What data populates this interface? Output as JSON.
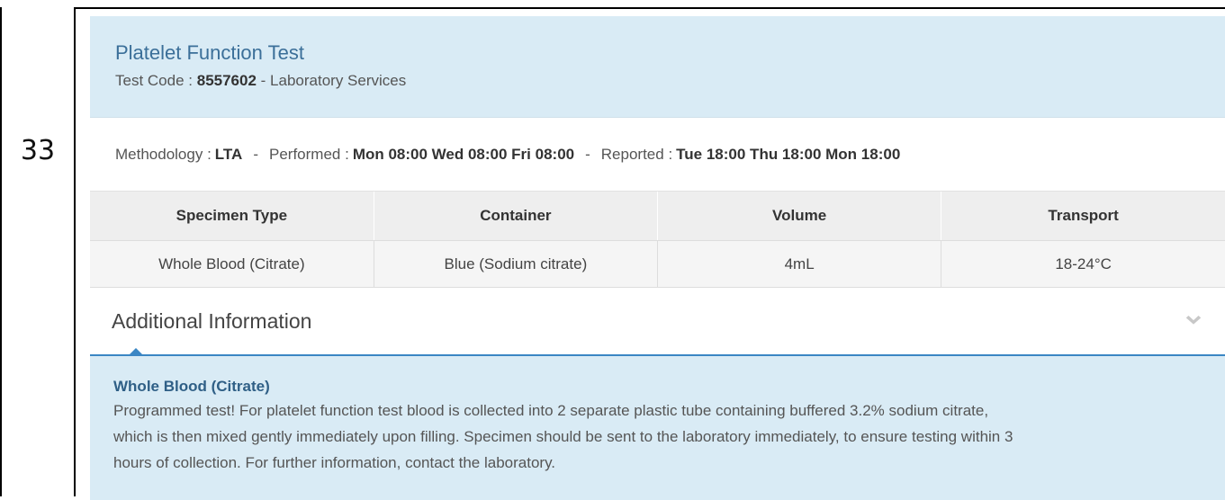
{
  "row_number": "33",
  "test": {
    "title": "Platelet Function Test",
    "code_label": "Test Code :",
    "code": "8557602",
    "department": "- Laboratory Services"
  },
  "methodology": {
    "methodology_label": "Methodology :",
    "methodology_value": "LTA",
    "separator": "-",
    "performed_label": "Performed :",
    "performed_value": "Mon 08:00 Wed 08:00 Fri 08:00",
    "reported_label": "Reported :",
    "reported_value": "Tue 18:00 Thu 18:00 Mon 18:00"
  },
  "specimen_table": {
    "headers": [
      "Specimen Type",
      "Container",
      "Volume",
      "Transport"
    ],
    "rows": [
      [
        "Whole Blood (Citrate)",
        "Blue (Sodium citrate)",
        "4mL",
        "18-24°C"
      ]
    ]
  },
  "additional": {
    "title": "Additional Information",
    "chevron_icon": "chevron-down-icon",
    "heading": "Whole Blood (Citrate)",
    "text": "Programmed test! For platelet function test blood is collected into 2 separate plastic tube containing buffered 3.2% sodium citrate, which is then mixed gently immediately upon filling. Specimen should be sent to the laboratory immediately, to ensure testing within 3 hours of collection. For further information, contact the laboratory."
  },
  "colors": {
    "header_bg": "#d9ebf5",
    "title_blue": "#3b6f99",
    "accent_blue": "#3b86c4"
  }
}
